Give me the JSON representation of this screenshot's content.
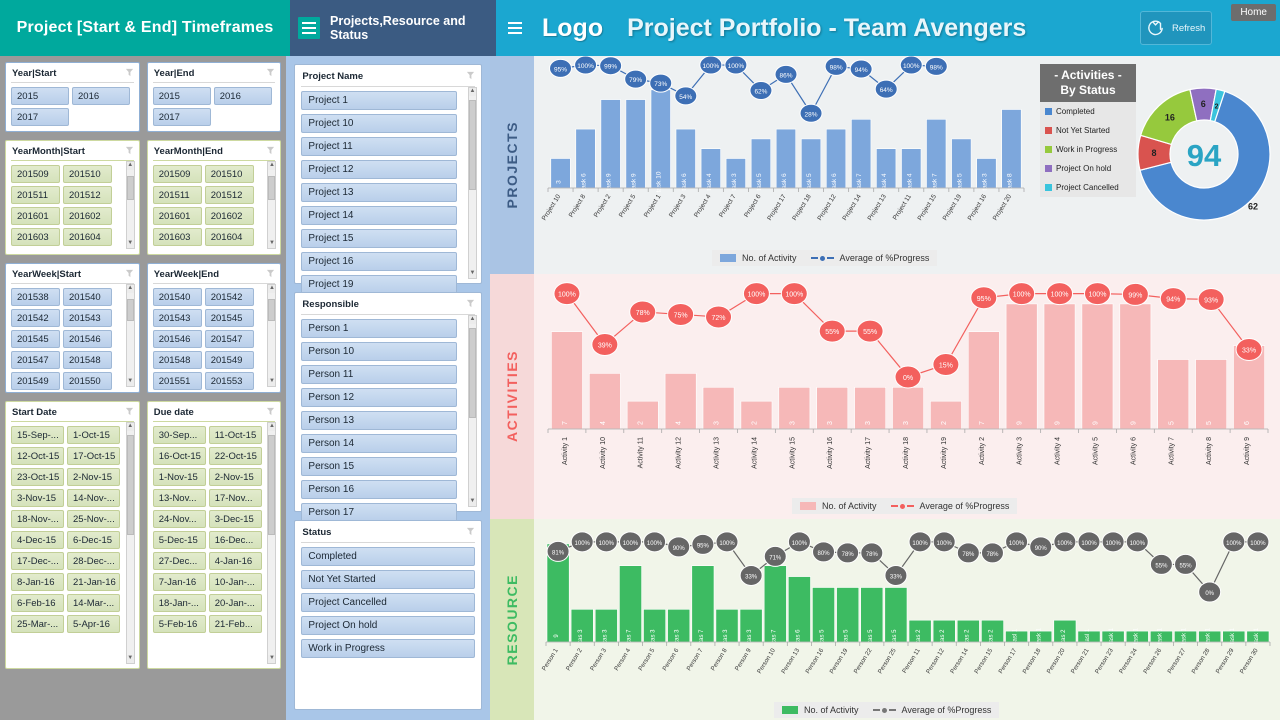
{
  "header": {
    "left_title": "Project [Start & End] Timeframes",
    "mid_title": "Projects,Resource and Status",
    "logo": "Logo",
    "title": "Project Portfolio - Team Avengers",
    "refresh_label": "Refresh",
    "refresh_icon": "refresh-icon",
    "home_label": "Home",
    "colors": {
      "teal": "#00a99d",
      "navy": "#3b5b82",
      "cyan": "#1ba7d0"
    }
  },
  "slicers": {
    "year_start": {
      "title": "Year|Start",
      "items": [
        "2015",
        "2016",
        "2017"
      ]
    },
    "year_end": {
      "title": "Year|End",
      "items": [
        "2015",
        "2016",
        "2017"
      ]
    },
    "yearmonth_start": {
      "title": "YearMonth|Start",
      "items": [
        "201509",
        "201510",
        "201511",
        "201512",
        "201601",
        "201602",
        "201603",
        "201604"
      ]
    },
    "yearmonth_end": {
      "title": "YearMonth|End",
      "items": [
        "201509",
        "201510",
        "201511",
        "201512",
        "201601",
        "201602",
        "201603",
        "201604"
      ]
    },
    "yearweek_start": {
      "title": "YearWeek|Start",
      "items": [
        "201538",
        "201540",
        "201542",
        "201543",
        "201545",
        "201546",
        "201547",
        "201548",
        "201549",
        "201550"
      ]
    },
    "yearweek_end": {
      "title": "YearWeek|End",
      "items": [
        "201540",
        "201542",
        "201543",
        "201545",
        "201546",
        "201547",
        "201548",
        "201549",
        "201551",
        "201553"
      ]
    },
    "start_date": {
      "title": "Start Date",
      "items": [
        "15-Sep-...",
        "1-Oct-15",
        "12-Oct-15",
        "17-Oct-15",
        "23-Oct-15",
        "2-Nov-15",
        "3-Nov-15",
        "14-Nov-...",
        "18-Nov-...",
        "25-Nov-...",
        "4-Dec-15",
        "6-Dec-15",
        "17-Dec-...",
        "28-Dec-...",
        "8-Jan-16",
        "21-Jan-16",
        "6-Feb-16",
        "14-Mar-...",
        "25-Mar-...",
        "5-Apr-16"
      ]
    },
    "due_date": {
      "title": "Due date",
      "items": [
        "30-Sep...",
        "11-Oct-15",
        "16-Oct-15",
        "22-Oct-15",
        "1-Nov-15",
        "2-Nov-15",
        "13-Nov...",
        "17-Nov...",
        "24-Nov...",
        "3-Dec-15",
        "5-Dec-15",
        "16-Dec...",
        "27-Dec...",
        "4-Jan-16",
        "7-Jan-16",
        "10-Jan-...",
        "18-Jan-...",
        "20-Jan-...",
        "5-Feb-16",
        "21-Feb..."
      ]
    },
    "project_name": {
      "title": "Project Name",
      "items": [
        "Project 1",
        "Project 10",
        "Project 11",
        "Project 12",
        "Project 13",
        "Project 14",
        "Project 15",
        "Project 16",
        "Project 19"
      ]
    },
    "responsible": {
      "title": "Responsible",
      "items": [
        "Person 1",
        "Person 10",
        "Person 11",
        "Person 12",
        "Person 13",
        "Person 14",
        "Person 15",
        "Person 16",
        "Person 17"
      ]
    },
    "status": {
      "title": "Status",
      "items": [
        "Completed",
        "Not Yet Started",
        "Project Cancelled",
        "Project On hold",
        "Work in Progress"
      ]
    },
    "filter_icon": "funnel-clear-icon"
  },
  "sections": {
    "projects": "PROJECTS",
    "activities": "ACTIVITIES",
    "resource": "RESOURCE"
  },
  "legends": {
    "activity_label": "No. of Activity",
    "progress_label": "Average of %Progress"
  },
  "donut_panel": {
    "title_line1": "Activities",
    "title_line2": "By Status",
    "center_value": "94",
    "collapse_left": "-",
    "collapse_right": "-",
    "legend": [
      {
        "label": "Completed",
        "color": "#4a87cf"
      },
      {
        "label": "Not Yet Started",
        "color": "#d9534f"
      },
      {
        "label": "Work in Progress",
        "color": "#96c93d"
      },
      {
        "label": "Project On hold",
        "color": "#8f6fc0"
      },
      {
        "label": "Project Cancelled",
        "color": "#3ac4dd"
      }
    ]
  },
  "chart_data": [
    {
      "type": "bar",
      "name": "projects",
      "title": "",
      "xlabel": "",
      "ylabel": "",
      "series_bar_name": "No. of Activity",
      "series_line_name": "Average of %Progress",
      "bar_color": "#7da7dc",
      "line_color": "#3d6fb5",
      "categories": [
        "Project 10",
        "Project 8",
        "Project 2",
        "Project 5",
        "Project 1",
        "Project 3",
        "Project 4",
        "Project 7",
        "Project 6",
        "Project 17",
        "Project 18",
        "Project 12",
        "Project 14",
        "Project 13",
        "Project 11",
        "Project 15",
        "Project 19",
        "Project 16",
        "Project 20"
      ],
      "values": [
        3,
        6,
        9,
        9,
        10,
        6,
        4,
        3,
        5,
        6,
        5,
        6,
        7,
        4,
        4,
        7,
        5,
        3,
        8
      ],
      "bar_labels": [
        "3",
        "task 6",
        "task 9",
        "task 9",
        "task 10",
        "task 6",
        "task 4",
        "task 3",
        "task 5",
        "task 6",
        "task 5",
        "task 6",
        "task 7",
        "task 4",
        "task 4",
        "task 7",
        "task 5",
        "task 3",
        "task 8"
      ],
      "progress": [
        95,
        100,
        99,
        79,
        73,
        54,
        100,
        100,
        62,
        86,
        28,
        98,
        94,
        64,
        100,
        98,
        null,
        null,
        null
      ],
      "progress_labels": [
        "95%",
        "100%",
        "99%",
        "79%",
        "73%",
        "54%",
        "100%",
        "100%",
        "62%",
        "86%",
        "28%",
        "98%",
        "94%",
        "64%",
        "100%",
        "98%"
      ],
      "ylim": [
        0,
        11
      ]
    },
    {
      "type": "bar",
      "name": "activities",
      "series_bar_name": "No. of Activity",
      "series_line_name": "Average of %Progress",
      "bar_color": "#f6b8b8",
      "line_color": "#f3605e",
      "categories": [
        "Activity 1",
        "Activity 10",
        "Activity 11",
        "Activity 12",
        "Activity 13",
        "Activity 14",
        "Activity 15",
        "Activity 16",
        "Activity 17",
        "Activity 18",
        "Activity 19",
        "Activity 2",
        "Activity 3",
        "Activity 4",
        "Activity 5",
        "Activity 6",
        "Activity 7",
        "Activity 8",
        "Activity 9"
      ],
      "values": [
        7,
        4,
        2,
        4,
        3,
        2,
        3,
        3,
        3,
        3,
        2,
        7,
        9,
        9,
        9,
        9,
        5,
        5,
        6
      ],
      "bar_labels": [
        "7",
        "4",
        "2",
        "4",
        "3",
        "2",
        "3",
        "3",
        "3",
        "3",
        "2",
        "7",
        "9",
        "9",
        "9",
        "9",
        "5",
        "5",
        "6"
      ],
      "progress": [
        100,
        39,
        78,
        75,
        72,
        100,
        100,
        55,
        55,
        0,
        15,
        95,
        100,
        100,
        100,
        99,
        94,
        93,
        33
      ],
      "progress_labels": [
        "100%",
        "39%",
        "78%",
        "75%",
        "72%",
        "100%",
        "100%",
        "55%",
        "55%",
        "0%",
        "15%",
        "95%",
        "100%",
        "100%",
        "100%",
        "99%",
        "94%",
        "93%",
        "33%"
      ],
      "ylim": [
        0,
        10
      ]
    },
    {
      "type": "bar",
      "name": "resource",
      "series_bar_name": "No. of Activity",
      "series_line_name": "Average of %Progress",
      "bar_color": "#3dbb62",
      "line_color": "#666666",
      "categories": [
        "Person 1",
        "Person 2",
        "Person 3",
        "Person 4",
        "Person 5",
        "Person 6",
        "Person 7",
        "Person 8",
        "Person 9",
        "Person 10",
        "Person 13",
        "Person 16",
        "Person 19",
        "Person 22",
        "Person 25",
        "Person 11",
        "Person 12",
        "Person 14",
        "Person 15",
        "Person 17",
        "Person 18",
        "Person 20",
        "Person 21",
        "Person 23",
        "Person 24",
        "Person 26",
        "Person 27",
        "Person 28",
        "Person 29",
        "Person 30"
      ],
      "values": [
        9,
        3,
        3,
        7,
        3,
        3,
        7,
        3,
        3,
        7,
        6,
        5,
        5,
        5,
        5,
        2,
        2,
        2,
        2,
        1,
        1,
        2,
        1,
        1,
        1,
        1,
        1,
        1,
        1,
        1
      ],
      "bar_labels": [
        "9",
        "tas 3",
        "tas 3",
        "tas 7",
        "tas 3",
        "tas 3",
        "tas 7",
        "tas 3",
        "tas 3",
        "tas 7",
        "tas 6",
        "tas 5",
        "tas 5",
        "tas 5",
        "tas 5",
        "tas 2",
        "tas 2",
        "tas 2",
        "tas 2",
        "tasl 1",
        "task 1",
        "tas 2",
        "tasl 1",
        "task 1",
        "task 1",
        "task 1",
        "task 1",
        "task 1",
        "task 1",
        "task 1"
      ],
      "progress": [
        81,
        100,
        100,
        100,
        100,
        90,
        95,
        100,
        33,
        71,
        100,
        80,
        78,
        78,
        33,
        100,
        100,
        78,
        78,
        100,
        90,
        100,
        100,
        100,
        100,
        55,
        55,
        0,
        100,
        100
      ],
      "progress_labels": [
        "81%",
        "100%",
        "100%",
        "100%",
        "100%",
        "90%",
        "95%",
        "100%",
        "33%",
        "71%",
        "100%",
        "80%",
        "78%",
        "78%",
        "33%",
        "100%",
        "100%",
        "78%",
        "78%",
        "100%",
        "90%",
        "100%",
        "100%",
        "100%",
        "100%",
        "55%",
        "55%",
        "0%",
        "100%",
        "100%"
      ],
      "ylim": [
        0,
        10
      ]
    },
    {
      "type": "pie",
      "name": "activities-by-status",
      "title": "Activities By Status",
      "center_value": 94,
      "labels": [
        "Completed",
        "Not Yet Started",
        "Work in Progress",
        "Project On hold",
        "Project Cancelled"
      ],
      "values": [
        62,
        8,
        16,
        6,
        2
      ],
      "colors": [
        "#4a87cf",
        "#d9534f",
        "#96c93d",
        "#8f6fc0",
        "#3ac4dd"
      ],
      "legend_position": "left"
    }
  ]
}
